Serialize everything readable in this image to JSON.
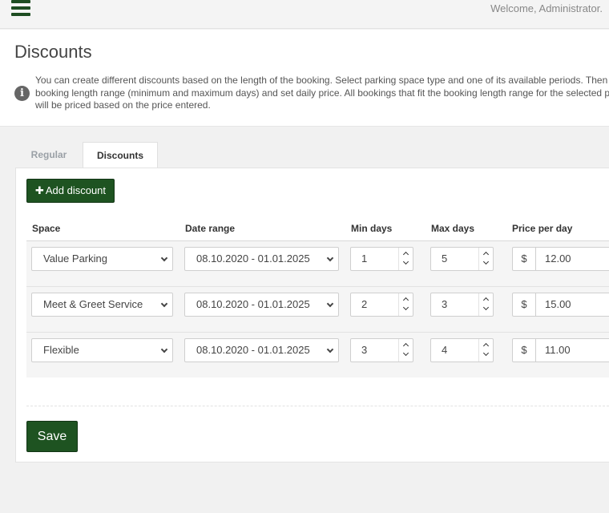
{
  "topbar": {
    "welcome": "Welcome, Administrator."
  },
  "header": {
    "title": "Discounts",
    "info": "You can create different discounts based on the length of the booking. Select parking space type and one of its available periods. Then add booking length range (minimum and maximum days) and set daily price. All bookings that fit the booking length range for the selected period will be priced based on the price entered."
  },
  "tabs": [
    {
      "label": "Regular",
      "active": false
    },
    {
      "label": "Discounts",
      "active": true
    }
  ],
  "add_button": {
    "icon": "plus-icon",
    "label": "Add discount"
  },
  "columns": [
    "Space",
    "Date range",
    "Min days",
    "Max days",
    "Price per day"
  ],
  "rows": [
    {
      "space": "Value Parking",
      "date_range": "08.10.2020 - 01.01.2025",
      "min_days": "1",
      "max_days": "5",
      "currency": "$",
      "price": "12.00"
    },
    {
      "space": "Meet & Greet Service",
      "date_range": "08.10.2020 - 01.01.2025",
      "min_days": "2",
      "max_days": "3",
      "currency": "$",
      "price": "15.00"
    },
    {
      "space": "Flexible",
      "date_range": "08.10.2020 - 01.01.2025",
      "min_days": "3",
      "max_days": "4",
      "currency": "$",
      "price": "11.00"
    }
  ],
  "save_button": {
    "label": "Save"
  },
  "colors": {
    "primary": "#1e5321",
    "background": "#f1f1f1"
  }
}
